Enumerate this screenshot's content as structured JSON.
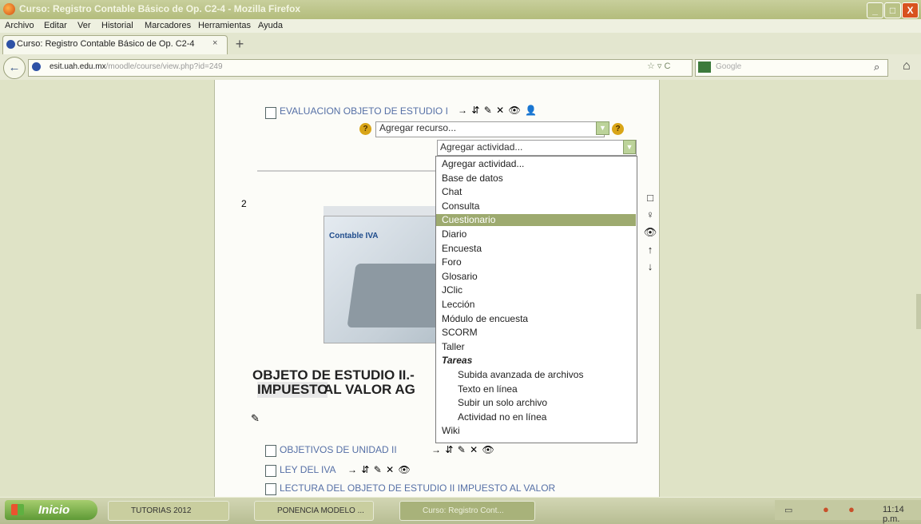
{
  "window": {
    "title": "Curso: Registro Contable Básico de Op. C2-4 - Mozilla Firefox",
    "controls": [
      "_",
      "□",
      "X"
    ]
  },
  "menu": [
    "Archivo",
    "Editar",
    "Ver",
    "Historial",
    "Marcadores",
    "Herramientas",
    "Ayuda"
  ],
  "tab": {
    "label": "Curso: Registro Contable Básico de Op. C2-4",
    "close": "×",
    "new_tab": "+"
  },
  "nav": {
    "back": "←",
    "url_domain": "esit.uah.edu.mx",
    "url_path": "/moodle/course/view.php?id=249",
    "search_placeholder": "Google",
    "search_icon": "search-icon",
    "home_icon": "home-icon",
    "url_icons": "☆ ▿ C"
  },
  "page": {
    "top_link": "EVALUACION OBJETO DE ESTUDIO I",
    "top_tools": "→ ⇵ ✎ ✕ 👁 👤",
    "select_recurso": "Agregar recurso...",
    "select_actividad": "Agregar actividad...",
    "section_number": "2",
    "thumb_logo": "Contable  IVA",
    "title_line1": "OBJETO DE ESTUDIO II.-",
    "title_line2_bold": "IMPUESTO",
    "title_line2_rest": " AL VALOR AG",
    "edit_icon": "✎",
    "links": [
      {
        "text": "OBJETIVOS DE UNIDAD II",
        "tools": "→ ⇵ ✎ ✕ 👁"
      },
      {
        "text": "LEY DEL IVA",
        "tools": "→ ⇵ ✎ ✕ 👁"
      },
      {
        "text": "LECTURA DEL OBJETO DE ESTUDIO II IMPUESTO AL VALOR",
        "tools": ""
      }
    ],
    "right_icons": [
      "□",
      "♀",
      "👁",
      "↑",
      "↓"
    ]
  },
  "dropdown": {
    "options": [
      {
        "label": "Agregar actividad...",
        "kind": "normal"
      },
      {
        "label": "Base de datos",
        "kind": "normal"
      },
      {
        "label": "Chat",
        "kind": "normal"
      },
      {
        "label": "Consulta",
        "kind": "normal"
      },
      {
        "label": "Cuestionario",
        "kind": "highlight"
      },
      {
        "label": "Diario",
        "kind": "normal"
      },
      {
        "label": "Encuesta",
        "kind": "normal"
      },
      {
        "label": "Foro",
        "kind": "normal"
      },
      {
        "label": "Glosario",
        "kind": "normal"
      },
      {
        "label": "JClic",
        "kind": "normal"
      },
      {
        "label": "Lección",
        "kind": "normal"
      },
      {
        "label": "Módulo de encuesta",
        "kind": "normal"
      },
      {
        "label": "SCORM",
        "kind": "normal"
      },
      {
        "label": "Taller",
        "kind": "normal"
      },
      {
        "label": "Tareas",
        "kind": "group"
      },
      {
        "label": "Subida avanzada de archivos",
        "kind": "sub"
      },
      {
        "label": "Texto en línea",
        "kind": "sub"
      },
      {
        "label": "Subir un solo archivo",
        "kind": "sub"
      },
      {
        "label": "Actividad no en línea",
        "kind": "sub"
      },
      {
        "label": "Wiki",
        "kind": "normal"
      }
    ]
  },
  "taskbar": {
    "start": "Inicio",
    "tasks": [
      "TUTORIAS 2012",
      "PONENCIA MODELO ...",
      "Curso: Registro Cont..."
    ],
    "clock": "11:14 p.m."
  }
}
